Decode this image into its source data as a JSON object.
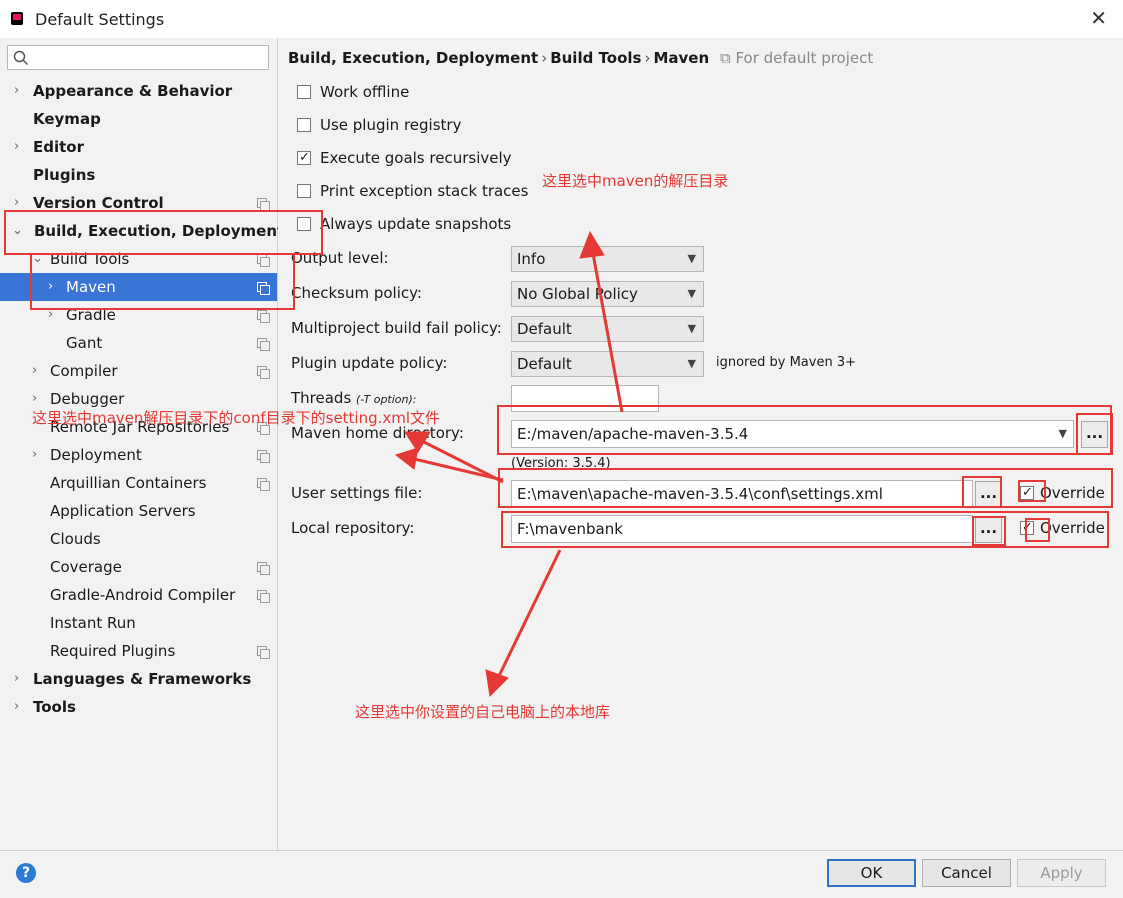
{
  "window": {
    "title": "Default Settings",
    "close": "✕"
  },
  "search": {
    "placeholder": ""
  },
  "sidebar": {
    "items": [
      {
        "label": "Appearance & Behavior"
      },
      {
        "label": "Keymap"
      },
      {
        "label": "Editor"
      },
      {
        "label": "Plugins"
      },
      {
        "label": "Version Control"
      },
      {
        "label": "Build, Execution, Deployment"
      },
      {
        "label": "Build Tools"
      },
      {
        "label": "Maven"
      },
      {
        "label": "Gradle"
      },
      {
        "label": "Gant"
      },
      {
        "label": "Compiler"
      },
      {
        "label": "Debugger"
      },
      {
        "label": "Remote Jar Repositories"
      },
      {
        "label": "Deployment"
      },
      {
        "label": "Arquillian Containers"
      },
      {
        "label": "Application Servers"
      },
      {
        "label": "Clouds"
      },
      {
        "label": "Coverage"
      },
      {
        "label": "Gradle-Android Compiler"
      },
      {
        "label": "Instant Run"
      },
      {
        "label": "Required Plugins"
      },
      {
        "label": "Languages & Frameworks"
      },
      {
        "label": "Tools"
      }
    ]
  },
  "breadcrumb": {
    "part1": "Build, Execution, Deployment",
    "part2": "Build Tools",
    "part3": "Maven",
    "sep": "›",
    "hint": "For default project"
  },
  "checkboxes": {
    "work_offline": {
      "label": "Work offline",
      "checked": false
    },
    "plugin_registry": {
      "label": "Use plugin registry",
      "checked": false
    },
    "execute_goals": {
      "label": "Execute goals recursively",
      "checked": true
    },
    "print_exception": {
      "label": "Print exception stack traces",
      "checked": false
    },
    "always_update": {
      "label": "Always update snapshots",
      "checked": false
    }
  },
  "form": {
    "output_level": {
      "label": "Output level:",
      "value": "Info"
    },
    "checksum_policy": {
      "label": "Checksum policy:",
      "value": "No Global Policy"
    },
    "multiproject_policy": {
      "label": "Multiproject build fail policy:",
      "value": "Default"
    },
    "plugin_update": {
      "label": "Plugin update policy:",
      "value": "Default",
      "note": "ignored by Maven 3+"
    },
    "threads": {
      "label": "Threads",
      "hint": "(-T option):",
      "value": ""
    },
    "maven_home": {
      "label": "Maven home directory:",
      "value": "E:/maven/apache-maven-3.5.4",
      "version": "(Version: 3.5.4)"
    },
    "user_settings": {
      "label": "User settings file:",
      "value": "E:\\maven\\apache-maven-3.5.4\\conf\\settings.xml",
      "override_label": "Override",
      "override_checked": true
    },
    "local_repo": {
      "label": "Local repository:",
      "value": "F:\\mavenbank",
      "override_label": "Override",
      "override_checked": true
    },
    "browse_label": "..."
  },
  "annotations": {
    "maven_dir": "这里选中maven的解压目录",
    "settings_file": "这里选中maven解压目录下的conf目录下的setting.xml文件",
    "local_repo": "这里选中你设置的自己电脑上的本地库",
    "color": "#e53935"
  },
  "footer": {
    "help": "?",
    "ok": "OK",
    "cancel": "Cancel",
    "apply": "Apply"
  }
}
